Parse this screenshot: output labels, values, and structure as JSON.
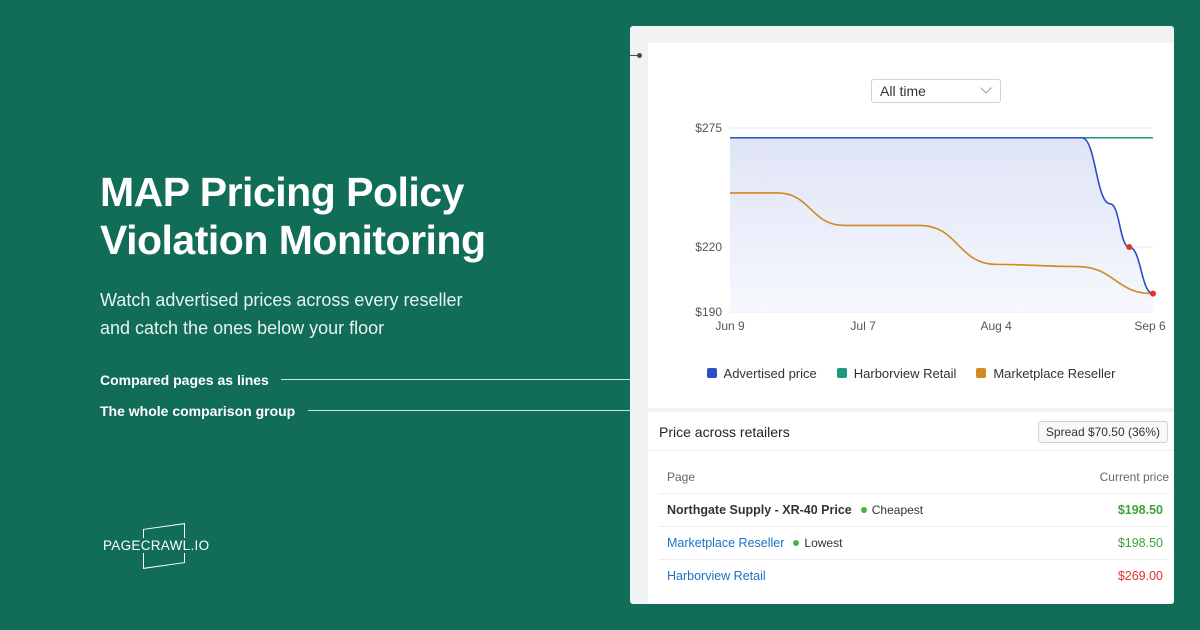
{
  "hero": {
    "title_line1": "MAP Pricing Policy",
    "title_line2": "Violation Monitoring",
    "subtitle_line1": "Watch advertised prices across every reseller",
    "subtitle_line2": "and catch the ones below your floor"
  },
  "annotations": [
    {
      "label": "Compared pages as lines"
    },
    {
      "label": "The whole comparison group"
    }
  ],
  "brand": {
    "logo_text": "PAGECRAWL.IO"
  },
  "chart_panel": {
    "range_select": {
      "value": "All time"
    }
  },
  "chart_data": {
    "type": "line",
    "x_tick_labels": [
      "Jun 9",
      "Jul 7",
      "Aug 4",
      "Sep 6"
    ],
    "y_tick_labels": [
      "$275",
      "$220",
      "$190"
    ],
    "ylim": [
      190,
      275
    ],
    "series": [
      {
        "name": "Advertised price",
        "color": "#2a4fc2",
        "points": [
          [
            "Jun 9",
            270.5
          ],
          [
            "Jul 7",
            270.5
          ],
          [
            "Aug 4",
            270.5
          ],
          [
            "Aug 22",
            270.5
          ],
          [
            "Aug 28",
            240
          ],
          [
            "Sep 1",
            220
          ],
          [
            "Sep 6",
            198.5
          ]
        ],
        "violation_points": [
          [
            "Sep 1",
            220
          ],
          [
            "Sep 6",
            198.5
          ]
        ]
      },
      {
        "name": "Harborview Retail",
        "color": "#1b9a80",
        "points": [
          [
            "Jun 9",
            270.5
          ],
          [
            "Sep 6",
            270.5
          ]
        ]
      },
      {
        "name": "Marketplace Reseller",
        "color": "#d08a1e",
        "points": [
          [
            "Jun 9",
            245
          ],
          [
            "Jun 19",
            245
          ],
          [
            "Jul 3",
            230
          ],
          [
            "Jul 19",
            230
          ],
          [
            "Aug 4",
            212
          ],
          [
            "Aug 21",
            211
          ],
          [
            "Sep 6",
            198.5
          ]
        ]
      }
    ],
    "grid": true,
    "legend_position": "bottom"
  },
  "table": {
    "title": "Price across retailers",
    "spread_badge": "Spread $70.50 (36%)",
    "columns": {
      "page": "Page",
      "current_price": "Current price"
    },
    "rows": [
      {
        "page": "Northgate Supply - XR-40 Price",
        "tag": "Cheapest",
        "price": "$198.50",
        "price_color": "#3aa53a",
        "style": "bold"
      },
      {
        "page": "Marketplace Reseller",
        "tag": "Lowest",
        "price": "$198.50",
        "price_color": "#3aa53a",
        "style": "link"
      },
      {
        "page": "Harborview Retail",
        "tag": "",
        "price": "$269.00",
        "price_color": "#e0302b",
        "style": "link"
      }
    ]
  }
}
